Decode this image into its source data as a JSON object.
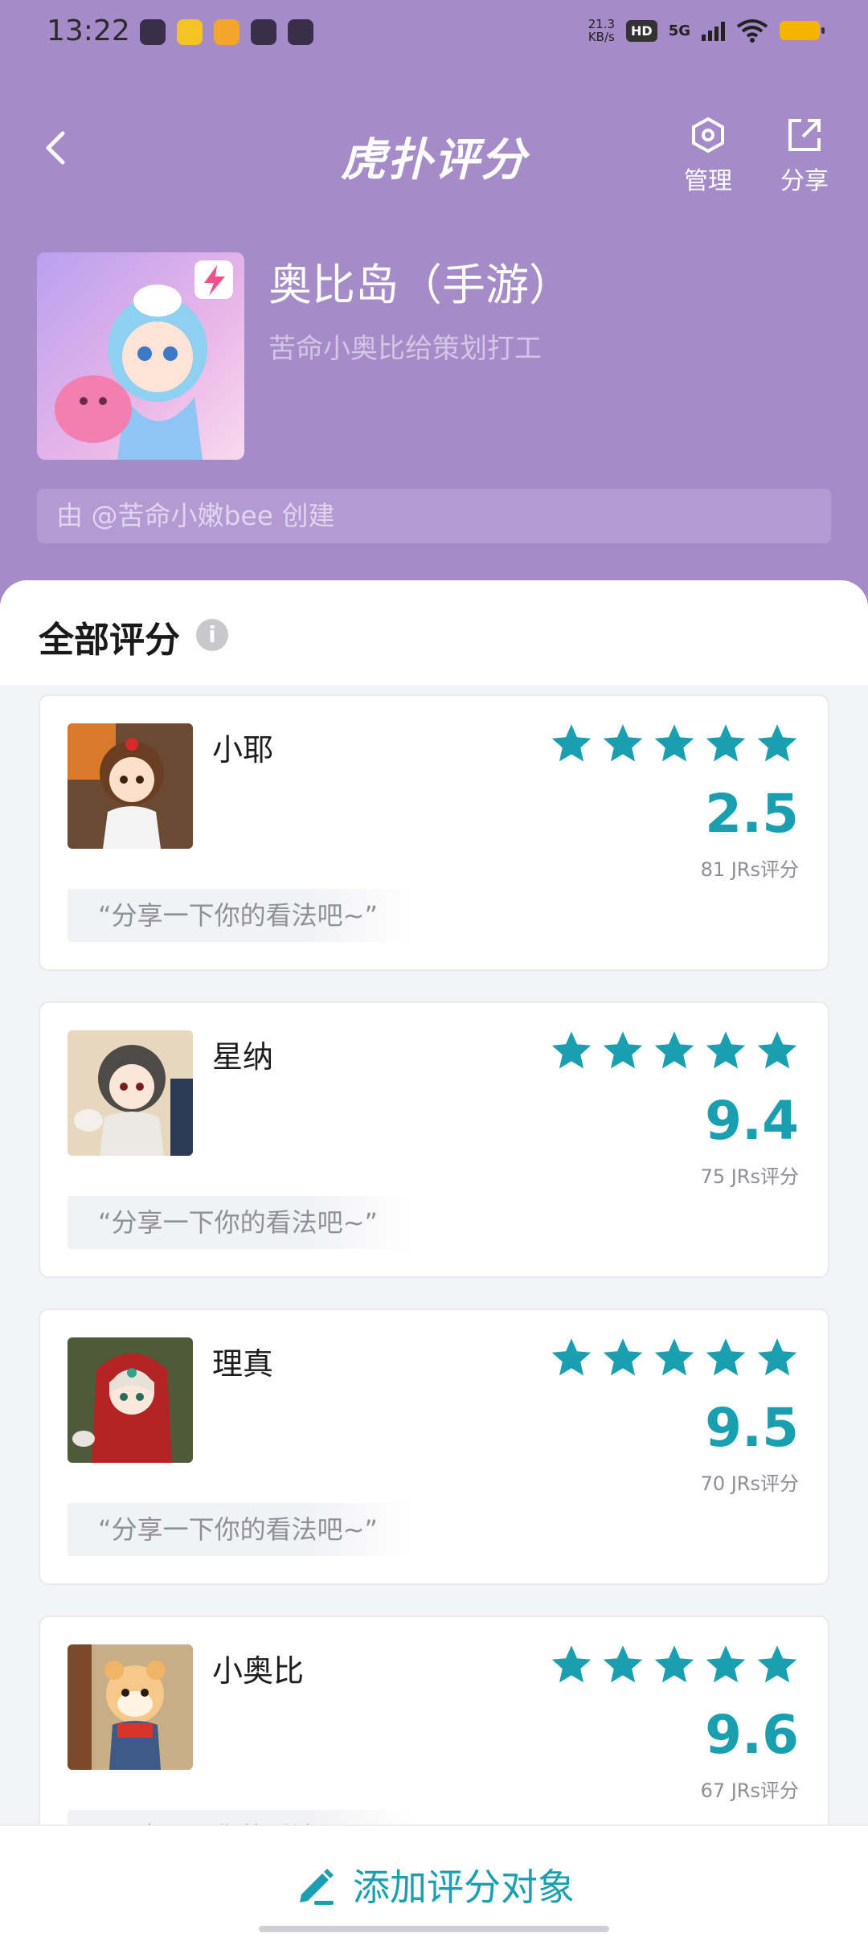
{
  "status": {
    "time": "13:22",
    "speed_value": "21.3",
    "speed_unit": "KB/s",
    "hd": "HD",
    "net": "5G"
  },
  "nav": {
    "logo": "虎扑评分",
    "manage_label": "管理",
    "share_label": "分享"
  },
  "entity": {
    "title": "奥比岛（手游）",
    "subtitle": "苦命小奥比给策划打工",
    "creator": "由 @苦命小嫩bee 创建"
  },
  "section": {
    "title": "全部评分"
  },
  "items": [
    {
      "name": "小耶",
      "score": "2.5",
      "count": "81 JRs评分",
      "comment": "“分享一下你的看法吧~”"
    },
    {
      "name": "星纳",
      "score": "9.4",
      "count": "75 JRs评分",
      "comment": "“分享一下你的看法吧~”"
    },
    {
      "name": "理真",
      "score": "9.5",
      "count": "70 JRs评分",
      "comment": "“分享一下你的看法吧~”"
    },
    {
      "name": "小奥比",
      "score": "9.6",
      "count": "67 JRs评分",
      "comment": "“分享一下你的看法吧~”"
    }
  ],
  "bottom": {
    "add_label": "添加评分对象"
  },
  "colors": {
    "header": "#a58bc8",
    "accent": "#1a9fb0"
  }
}
